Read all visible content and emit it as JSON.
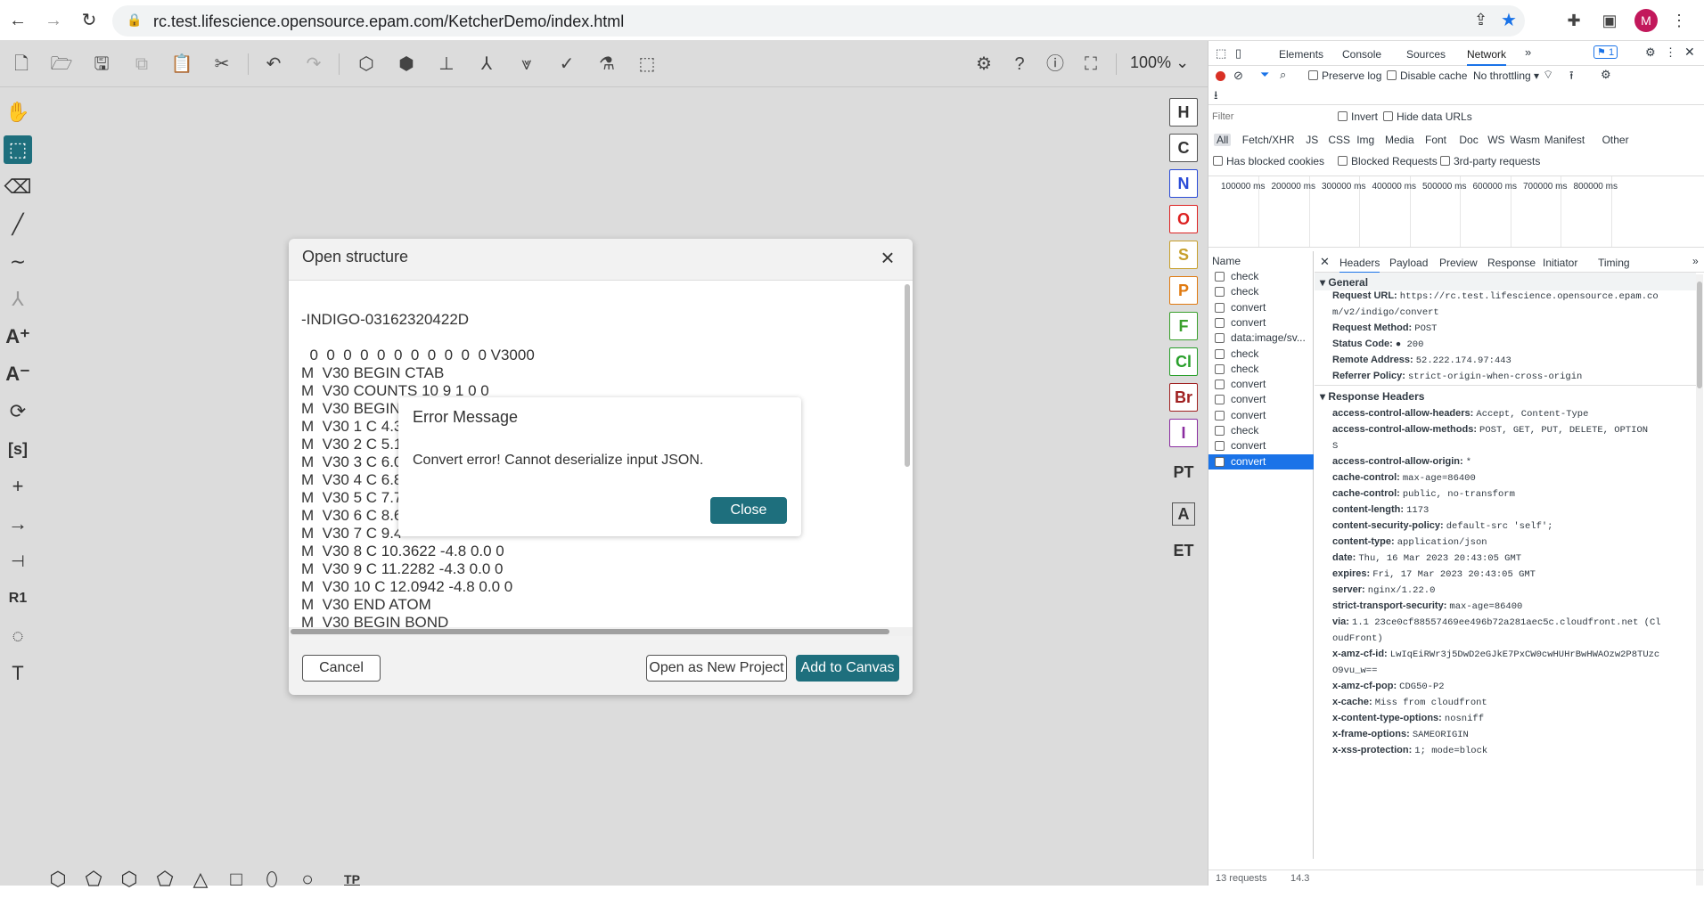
{
  "browser": {
    "url": "rc.test.lifescience.opensource.epam.com/KetcherDemo/index.html",
    "profile_initial": "M"
  },
  "ketcher": {
    "zoom": "100%",
    "right_atoms": [
      "H",
      "C",
      "N",
      "O",
      "S",
      "P",
      "F",
      "Cl",
      "Br",
      "I"
    ],
    "right_extra": [
      "PT",
      "A",
      "ET"
    ],
    "bottom_tp": "TP"
  },
  "open_dialog": {
    "title": "Open structure",
    "content_lines": [
      "-INDIGO-03162320422D",
      "",
      "  0  0  0  0  0  0  0  0  0  0  0 V3000",
      "M  V30 BEGIN CTAB",
      "M  V30 COUNTS 10 9 1 0 0",
      "M  V30 BEGIN",
      "M  V30 1 C 4.3",
      "M  V30 2 C 5.1",
      "M  V30 3 C 6.0",
      "M  V30 4 C 6.8",
      "M  V30 5 C 7.7",
      "M  V30 6 C 8.6",
      "M  V30 7 C 9.4",
      "M  V30 8 C 10.3622 -4.8 0.0 0",
      "M  V30 9 C 11.2282 -4.3 0.0 0",
      "M  V30 10 C 12.0942 -4.8 0.0 0",
      "M  V30 END ATOM",
      "M  V30 BEGIN BOND"
    ],
    "cancel": "Cancel",
    "open_new": "Open as New Project",
    "add_canvas": "Add to Canvas"
  },
  "error_dialog": {
    "title": "Error Message",
    "message": "Convert error! Cannot deserialize input JSON.",
    "close": "Close"
  },
  "devtools": {
    "tabs": [
      "Elements",
      "Console",
      "Sources",
      "Network"
    ],
    "issues": "1",
    "preserve_log": "Preserve log",
    "disable_cache": "Disable cache",
    "throttling": "No throttling",
    "filter_placeholder": "Filter",
    "invert": "Invert",
    "hide_data_urls": "Hide data URLs",
    "type_filters": [
      "All",
      "Fetch/XHR",
      "JS",
      "CSS",
      "Img",
      "Media",
      "Font",
      "Doc",
      "WS",
      "Wasm",
      "Manifest",
      "Other"
    ],
    "has_blocked": "Has blocked cookies",
    "blocked_requests": "Blocked Requests",
    "third_party": "3rd-party requests",
    "timeline": [
      "100000 ms",
      "200000 ms",
      "300000 ms",
      "400000 ms",
      "500000 ms",
      "600000 ms",
      "700000 ms",
      "800000 ms"
    ],
    "name_header": "Name",
    "requests": [
      "check",
      "check",
      "convert",
      "convert",
      "data:image/sv...",
      "check",
      "check",
      "convert",
      "convert",
      "convert",
      "check",
      "convert",
      "convert"
    ],
    "detail_tabs": [
      "Headers",
      "Payload",
      "Preview",
      "Response",
      "Initiator",
      "Timing"
    ],
    "general_title": "General",
    "general": [
      {
        "k": "Request URL:",
        "v": "https://rc.test.lifescience.opensource.epam.co"
      },
      {
        "k": "",
        "v": "m/v2/indigo/convert"
      },
      {
        "k": "Request Method:",
        "v": "POST"
      },
      {
        "k": "Status Code:",
        "v": "● 200"
      },
      {
        "k": "Remote Address:",
        "v": "52.222.174.97:443"
      },
      {
        "k": "Referrer Policy:",
        "v": "strict-origin-when-cross-origin"
      }
    ],
    "resp_title": "Response Headers",
    "response": [
      {
        "k": "access-control-allow-headers:",
        "v": "Accept, Content-Type"
      },
      {
        "k": "access-control-allow-methods:",
        "v": "POST, GET, PUT, DELETE, OPTION"
      },
      {
        "k": "",
        "v": "S"
      },
      {
        "k": "access-control-allow-origin:",
        "v": "*"
      },
      {
        "k": "cache-control:",
        "v": "max-age=86400"
      },
      {
        "k": "cache-control:",
        "v": "public, no-transform"
      },
      {
        "k": "content-length:",
        "v": "1173"
      },
      {
        "k": "content-security-policy:",
        "v": "default-src 'self';"
      },
      {
        "k": "content-type:",
        "v": "application/json"
      },
      {
        "k": "date:",
        "v": "Thu, 16 Mar 2023 20:43:05 GMT"
      },
      {
        "k": "expires:",
        "v": "Fri, 17 Mar 2023 20:43:05 GMT"
      },
      {
        "k": "server:",
        "v": "nginx/1.22.0"
      },
      {
        "k": "strict-transport-security:",
        "v": "max-age=86400"
      },
      {
        "k": "via:",
        "v": "1.1 23ce0cf88557469ee496b72a281aec5c.cloudfront.net (Cl"
      },
      {
        "k": "",
        "v": "oudFront)"
      },
      {
        "k": "x-amz-cf-id:",
        "v": "LwIqEiRWr3j5DwD2eGJkE7PxCW0cwHUHrBwHWAOzw2P8TUzc"
      },
      {
        "k": "",
        "v": "O9vu_w=="
      },
      {
        "k": "x-amz-cf-pop:",
        "v": "CDG50-P2"
      },
      {
        "k": "x-cache:",
        "v": "Miss from cloudfront"
      },
      {
        "k": "x-content-type-options:",
        "v": "nosniff"
      },
      {
        "k": "x-frame-options:",
        "v": "SAMEORIGIN"
      },
      {
        "k": "x-xss-protection:",
        "v": "1; mode=block"
      }
    ],
    "status_requests": "13 requests",
    "status_size": "14.3"
  }
}
